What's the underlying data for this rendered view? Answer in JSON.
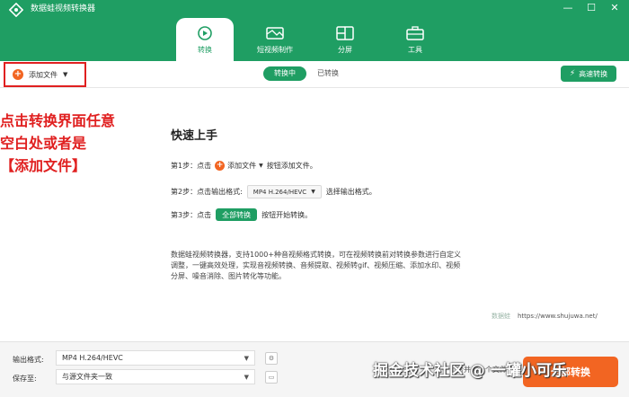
{
  "window": {
    "title": "数据蛙视频转换器",
    "controls": [
      "—",
      "☐",
      "✕"
    ]
  },
  "tabs": [
    {
      "label": "转换",
      "icon": "convert-icon",
      "active": true
    },
    {
      "label": "短视频制作",
      "icon": "video-maker-icon",
      "active": false
    },
    {
      "label": "分屏",
      "icon": "split-screen-icon",
      "active": false
    },
    {
      "label": "工具",
      "icon": "toolbox-icon",
      "active": false
    }
  ],
  "toolbar": {
    "add_file": "添加文件",
    "subtabs": [
      "转换中",
      "已转换"
    ],
    "fast_convert": "高速转换"
  },
  "annotation": {
    "lines": [
      "点击转换界面任意",
      "空白处或者是",
      "【添加文件】"
    ],
    "color": "#e02020"
  },
  "quickstart": {
    "title": "快速上手",
    "step1": {
      "prefix": "第1步：点击",
      "button": "添加文件",
      "suffix": "按钮添加文件。"
    },
    "step2": {
      "prefix": "第2步：点击输出格式:",
      "format": "MP4 H.264/HEVC",
      "suffix": "选择输出格式。"
    },
    "step3": {
      "prefix": "第3步：点击",
      "button": "全部转换",
      "suffix": "按钮开始转换。"
    },
    "description": "数据蛙视频转换器，支持1000+种音视频格式转换，可在视频转换前对转换参数进行自定义调整，一键高效处理，实现音视频转换、音频提取、视频转gif、视频压缩、添加水印、视频分屏、噪音消除、图片转化等功能。",
    "brand": "数据蛙",
    "url": "https://www.shujuwa.net/"
  },
  "bottom": {
    "output_format_label": "输出格式:",
    "output_format_value": "MP4 H.264/HEVC",
    "save_to_label": "保存至:",
    "save_to_value": "与源文件夹一致",
    "merge_label": "合并成一个文件",
    "convert_all": "全部转换"
  },
  "watermark": "掘金技术社区 @ 一罐小可乐",
  "colors": {
    "accent": "#1f9e63",
    "orange": "#f26522"
  }
}
